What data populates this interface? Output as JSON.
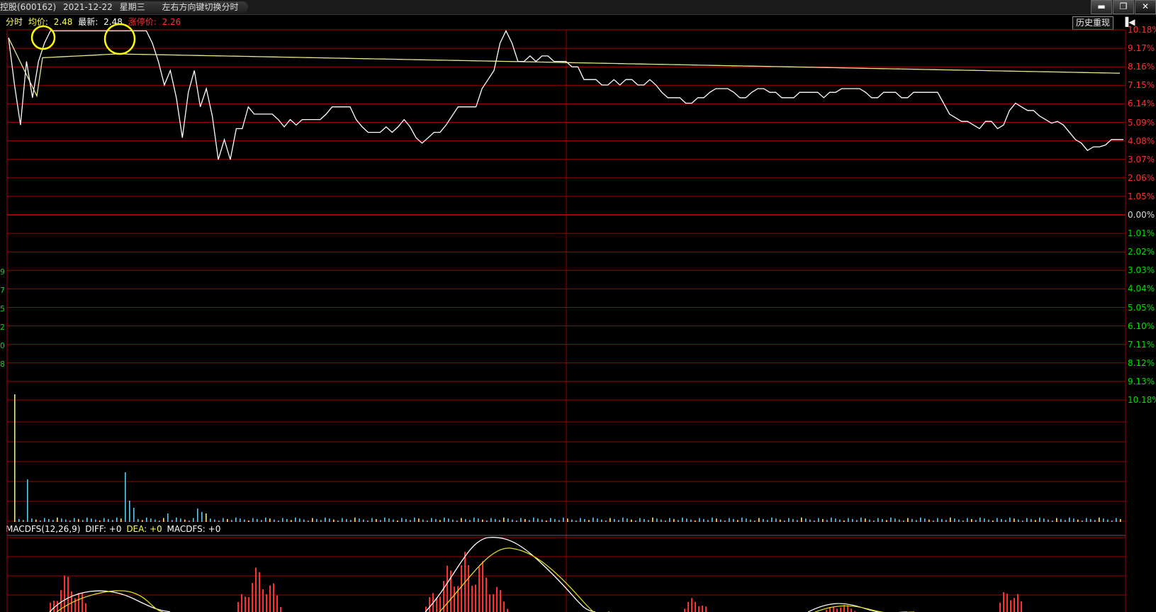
{
  "window": {
    "stock": "控股(600162)",
    "date": "2021-12-22",
    "weekday": "星期三",
    "hint": "左右方向键切换分时",
    "buttons": {
      "minimize": "▬",
      "restore": "❐",
      "close": "✕"
    }
  },
  "info": {
    "mode": "分时",
    "avg_label": "均价:",
    "avg_value": "2.48",
    "latest_label": "最新:",
    "latest_value": "2.48",
    "limit_label": "涨停价:",
    "limit_value": "2.26"
  },
  "history_button": "历史重现",
  "back_icon": "back-arrow-icon",
  "pct_labels": [
    "10.18%",
    "9.17%",
    "8.16%",
    "7.15%",
    "6.14%",
    "5.09%",
    "4.08%",
    "3.07%",
    "2.06%",
    "1.05%",
    "0.00%",
    "1.01%",
    "2.02%",
    "3.03%",
    "4.04%",
    "5.05%",
    "6.10%",
    "7.11%",
    "8.12%",
    "9.13%",
    "10.18%"
  ],
  "left_digits": [
    "9",
    "7",
    "5",
    "2",
    "0",
    "8"
  ],
  "macd": {
    "name": "MACDFS(12,26,9)",
    "diff": "DIFF: +0",
    "dea": "DEA: +0",
    "macdfs": "MACDFS: +0"
  },
  "colors": {
    "grid": "#a00000",
    "price_line": "#ffffff",
    "avg_line": "#e8e890",
    "vol_up": "#60c8e8",
    "vol_flat": "#e8e890",
    "macd_bar": "#ff3030",
    "highlight": "#ffff00"
  },
  "chart_data": {
    "type": "line",
    "ylim": [
      -10.18,
      10.18
    ],
    "price_pct": [
      9.8,
      7.2,
      5,
      8.5,
      6.5,
      8.5,
      9.5,
      10.18,
      10.18,
      10.18,
      10.18,
      10.18,
      10.18,
      10.18,
      10.18,
      10.18,
      10.18,
      10.18,
      10.18,
      10.18,
      10.18,
      10.18,
      10.18,
      10.18,
      9.5,
      8.5,
      7.2,
      8,
      6.5,
      4.3,
      6.8,
      8,
      6,
      7,
      5.5,
      3.1,
      4.2,
      3.1,
      4.8,
      4.8,
      6,
      5.6,
      5.6,
      5.6,
      5.6,
      5.3,
      4.9,
      5.3,
      5,
      5.3,
      5.3,
      5.3,
      5.3,
      5.6,
      6,
      6,
      6,
      6,
      5.3,
      4.9,
      4.6,
      4.6,
      4.6,
      4.9,
      4.6,
      4.9,
      5.3,
      4.9,
      4.3,
      4,
      4.3,
      4.6,
      4.6,
      5,
      5.5,
      6,
      6,
      6,
      6,
      7,
      7.5,
      8,
      9.5,
      10.18,
      9.5,
      8.5,
      8.5,
      8.8,
      8.5,
      8.8,
      8.8,
      8.5,
      8.5,
      8.5,
      8.2,
      8.2,
      7.5,
      7.5,
      7.5,
      7.2,
      7.2,
      7.5,
      7.2,
      7.5,
      7.5,
      7.2,
      7.2,
      7.5,
      7.2,
      6.8,
      6.5,
      6.5,
      6.5,
      6.2,
      6.2,
      6.5,
      6.5,
      6.8,
      7,
      7,
      7,
      6.8,
      6.5,
      6.5,
      6.8,
      7,
      7,
      6.8,
      6.8,
      6.5,
      6.5,
      6.5,
      6.8,
      6.8,
      6.8,
      6.8,
      6.5,
      6.8,
      6.8,
      7,
      7,
      7,
      7,
      6.8,
      6.5,
      6.5,
      6.8,
      6.8,
      6.8,
      6.5,
      6.5,
      6.8,
      6.8,
      6.8,
      6.8,
      6.8,
      6.2,
      5.6,
      5.4,
      5.2,
      5.2,
      5,
      4.8,
      5.2,
      5.2,
      4.8,
      5,
      5.8,
      6.2,
      6,
      5.8,
      5.8,
      5.5,
      5.3,
      5.1,
      5.2,
      5,
      4.6,
      4.2,
      4,
      3.6,
      3.8,
      3.8,
      3.9,
      4.2,
      4.2,
      4.2
    ]
  }
}
